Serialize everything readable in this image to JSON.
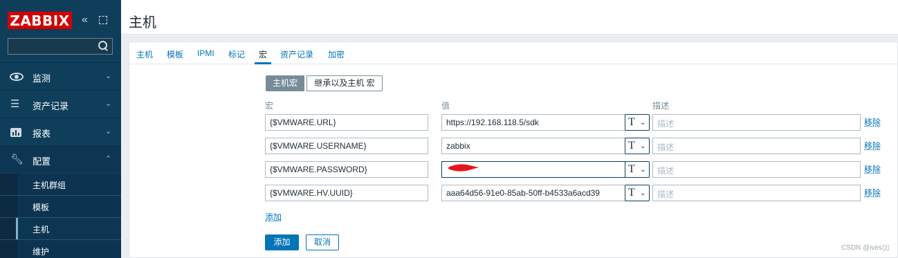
{
  "brand": {
    "logo_text": "ZABBIX",
    "logo_color": "#d40000",
    "sidebar_color": "#0f3e5a",
    "accent": "#0275b8"
  },
  "sidebar": {
    "collapse_icon": "double-chevron-left-icon",
    "kiosk_icon": "fullscreen-icon",
    "search": {
      "placeholder": "",
      "icon": "search-icon"
    },
    "menu": [
      {
        "label": "监测",
        "icon": "eye-icon",
        "chevron": "⌄"
      },
      {
        "label": "资产记录",
        "icon": "list-icon",
        "chevron": "⌄"
      },
      {
        "label": "报表",
        "icon": "bar-chart-icon",
        "chevron": "⌄"
      },
      {
        "label": "配置",
        "icon": "wrench-icon",
        "chevron": "⌃"
      }
    ],
    "submenu": [
      {
        "label": "主机群组"
      },
      {
        "label": "模板"
      },
      {
        "label": "主机"
      },
      {
        "label": "维护"
      }
    ]
  },
  "header": {
    "title": "主机"
  },
  "tabs": [
    "主机",
    "模板",
    "IPMI",
    "标记",
    "宏",
    "资产记录",
    "加密"
  ],
  "selected_tab": "宏",
  "macro_mode": {
    "active": "主机宏",
    "other": "继承以及主机 宏"
  },
  "columns": {
    "macro": "宏",
    "value": "值",
    "description": "描述"
  },
  "rows": [
    {
      "macro": "{$VMWARE.URL}",
      "value": "https://192.168.118.5/sdk",
      "type": "T",
      "description_placeholder": "描述",
      "remove": "移除"
    },
    {
      "macro": "{$VMWARE.USERNAME}",
      "value": "zabbix",
      "type": "T",
      "description_placeholder": "描述",
      "remove": "移除"
    },
    {
      "macro": "{$VMWARE.PASSWORD}",
      "value": "",
      "type": "T",
      "description_placeholder": "描述",
      "remove": "移除"
    },
    {
      "macro": "{$VMWARE.HV.UUID}",
      "value": "aaa64d56-91e0-85ab-50ff-b4533a6acd39",
      "type": "T",
      "description_placeholder": "描述",
      "remove": "移除"
    }
  ],
  "add_link": "添加",
  "buttons": {
    "add": "添加",
    "cancel": "取消"
  },
  "watermark": "CSDN @ives▯▯"
}
